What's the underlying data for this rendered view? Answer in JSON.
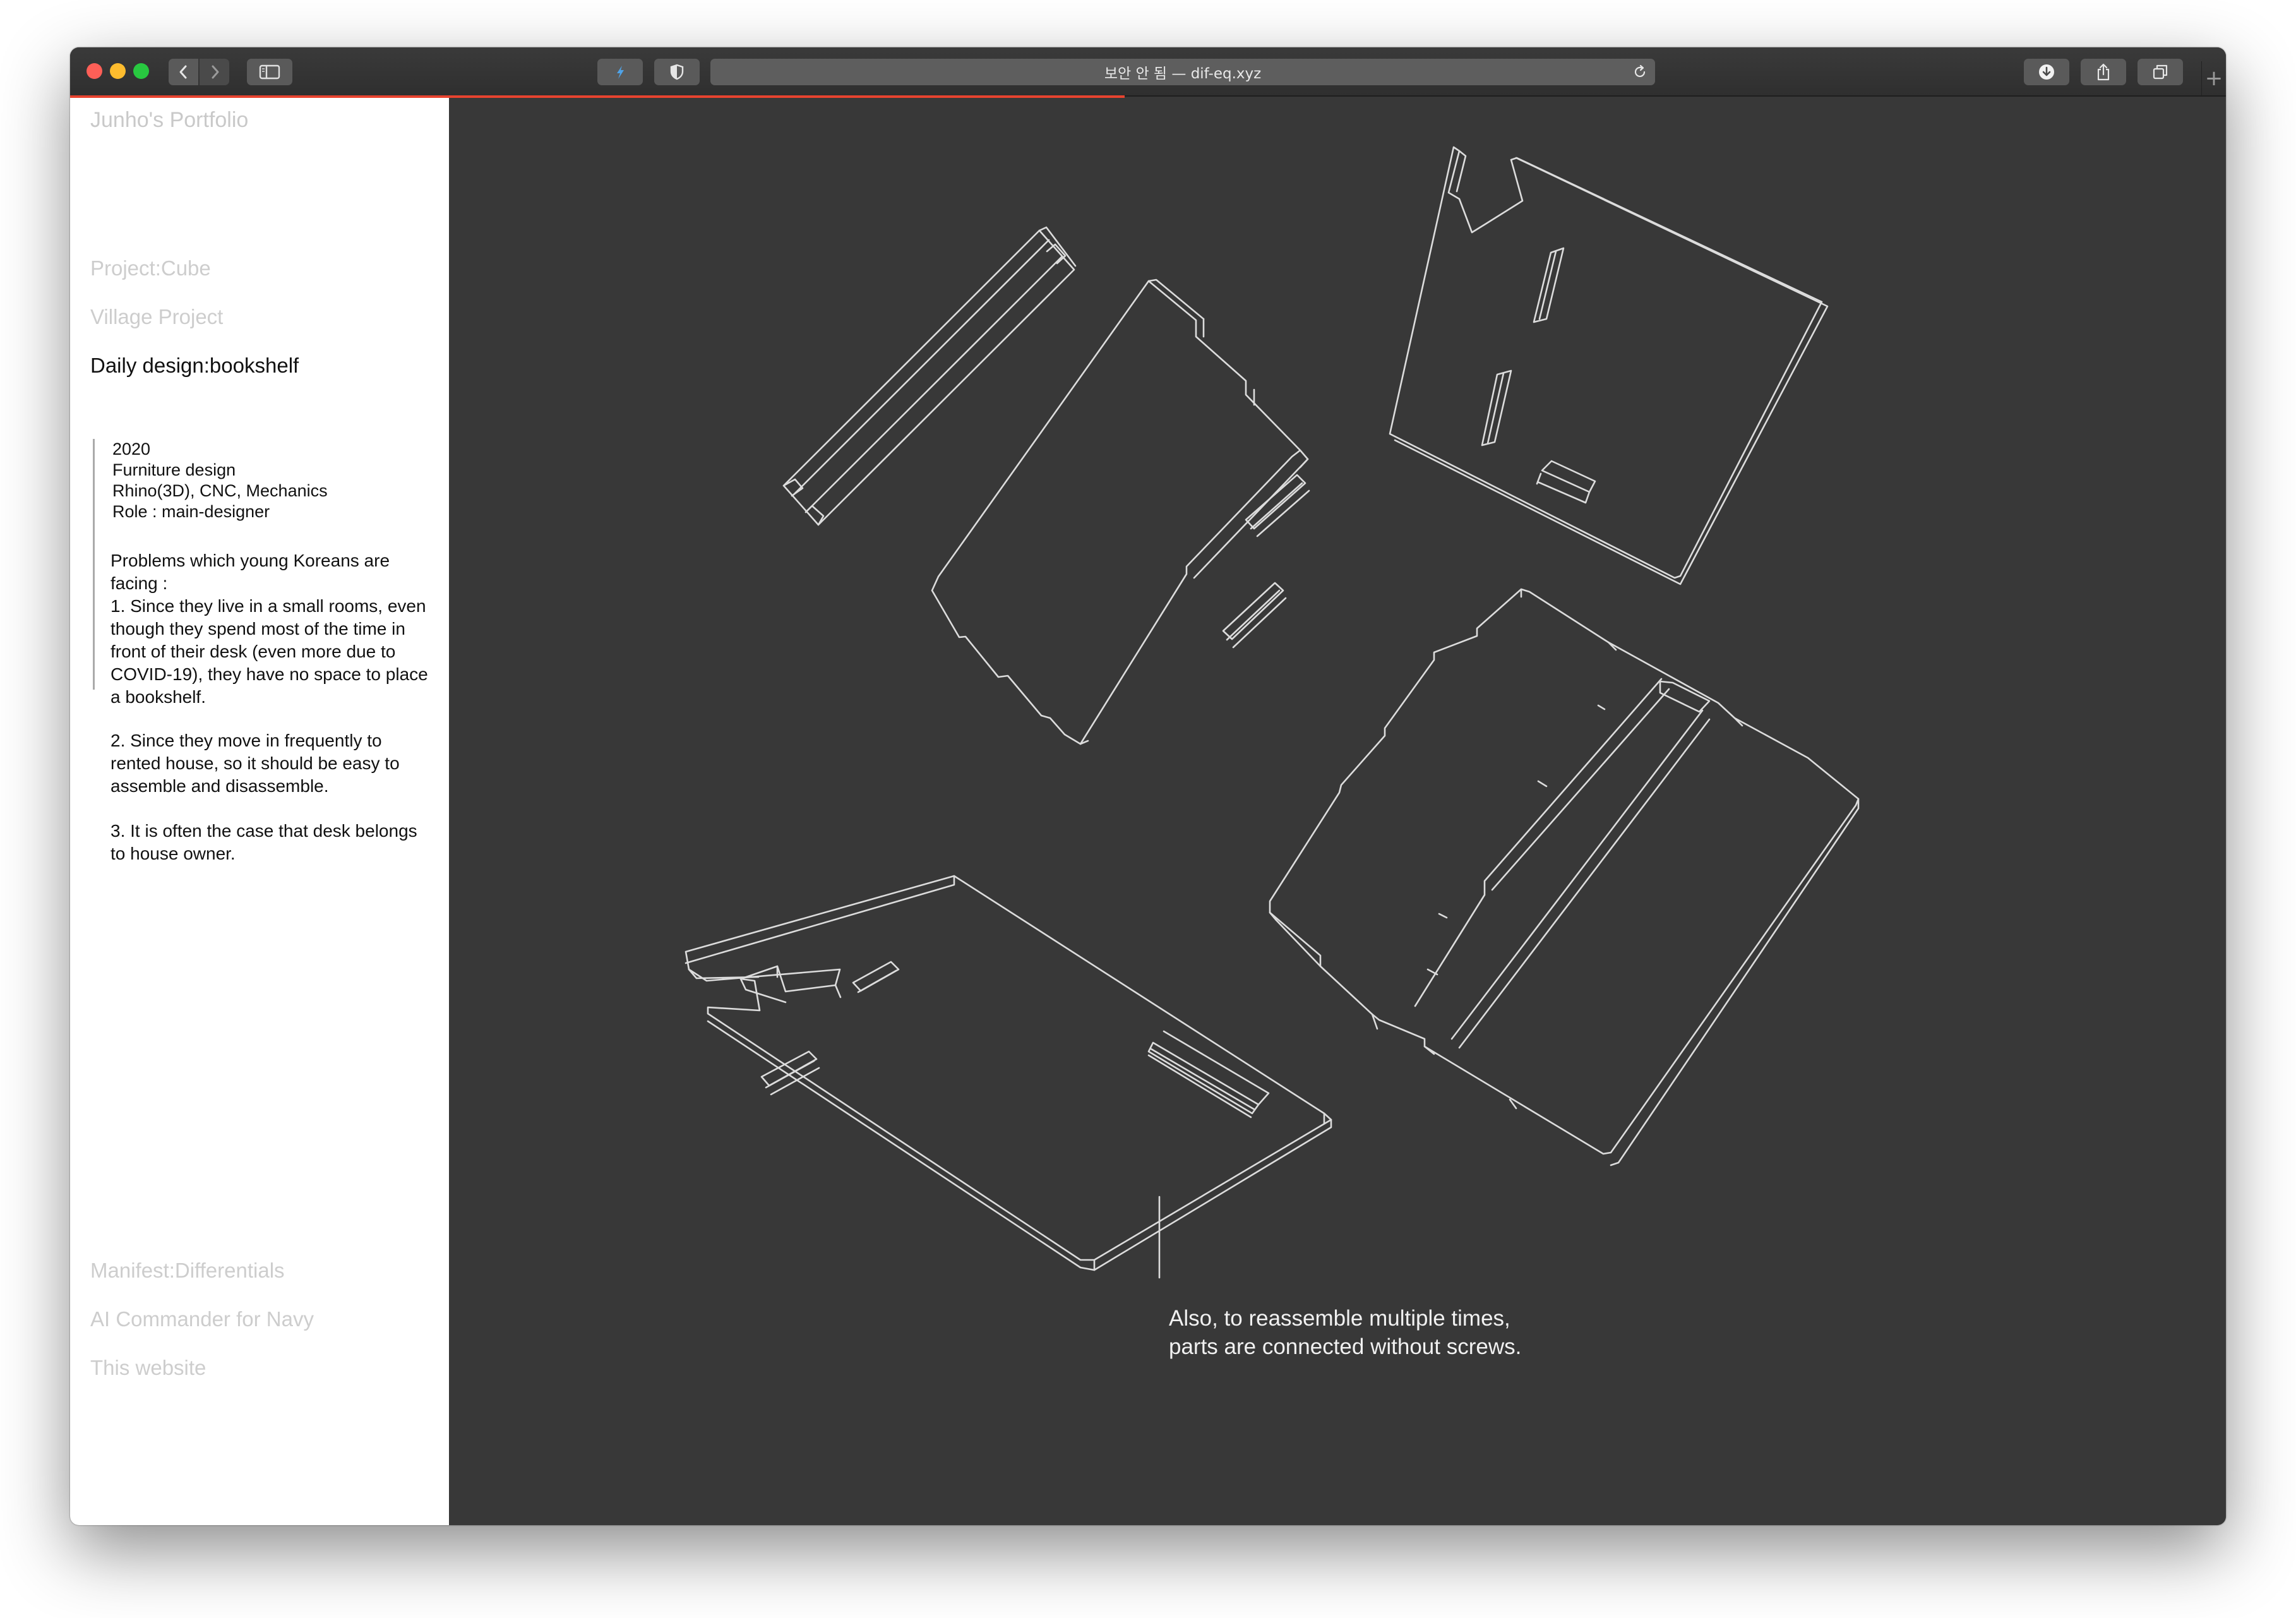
{
  "browser": {
    "address": "보안 안 됨 — dif-eq.xyz",
    "new_tab_label": "+"
  },
  "sidebar": {
    "site_title": "Junho's Portfolio",
    "nav_top": [
      "Project:Cube",
      "Village Project"
    ],
    "active_item": "Daily design:bookshelf",
    "meta": {
      "year": "2020",
      "category": "Furniture design",
      "tools": "Rhino(3D), CNC, Mechanics",
      "role": "Role : main-designer"
    },
    "description": [
      "Problems which young Koreans are facing :\n1. Since they live in a small rooms, even though they spend most of the time in front of their desk (even more due to COVID-19), they have no space to place a bookshelf.",
      "2. Since they move in frequently to rented house, so it should be easy to assemble and disassemble.",
      "3. It is often the case that desk belongs to house owner."
    ],
    "nav_bottom": [
      "Manifest:Differentials",
      "AI Commander for Navy",
      "This website"
    ]
  },
  "main": {
    "caption": "Also, to reassemble multiple times,\nparts are connected without screws."
  },
  "colors": {
    "page_dark": "#383838",
    "sidebar_bg": "#ffffff",
    "line": "#dcdcdc",
    "progress": "#e8432f",
    "inactive_nav": "#cdcdcd"
  }
}
